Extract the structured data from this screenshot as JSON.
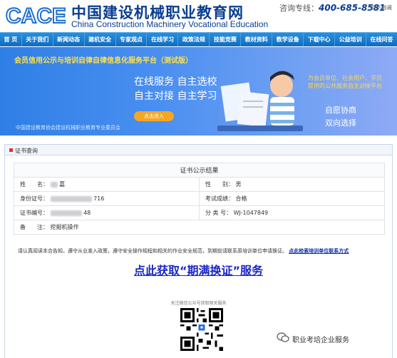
{
  "header": {
    "logo_letters": "CACE",
    "logo_cn": "中国建设机械职业教育网",
    "logo_en": "China Construction Machinery Vocational Education",
    "hotline_label": "咨询专线：",
    "hotline_number": "400-685-8581",
    "favorite": "加入收藏"
  },
  "nav": {
    "items": [
      "首 页",
      "关于我们",
      "新闻动态",
      "建机安全",
      "专家观点",
      "在线学习",
      "政策法规",
      "技能竞赛",
      "教材资料",
      "教学设备",
      "下载中心",
      "公益培训",
      "在线问答"
    ]
  },
  "banner": {
    "title": "会员信用公示与培训自律自律信息化服务平台（测试版）",
    "slogan1": "在线服务 自主选校",
    "slogan2": "自主对接 自主学习",
    "button": "点击进入",
    "org": "中国建设教育协会建设机械职业教育专业委员会",
    "right_text": "为会员单位、社会用户、学员提供的公共服务自主对接平台",
    "right2": "自愿协商",
    "right3": "双向选择"
  },
  "query": {
    "title": "证书查询"
  },
  "result": {
    "caption": "证书公示结果",
    "name_label": "姓　　名：",
    "name_value": "嘉",
    "gender_label": "性　　别：",
    "gender_value": "男",
    "id_label": "身份证号：",
    "id_value": "716",
    "exam_label": "考试成绩：",
    "exam_value": "合格",
    "cert_label": "证书编号：",
    "cert_value": "48",
    "class_label": "分 类 号：",
    "class_value": "WJ-1047849",
    "note_label": "备　　注：",
    "note_value": "挖掘机操作"
  },
  "notice": {
    "text": "请认真阅读本合告知，遵守从业准入政策，遵守安全操作规程和相关的作业安全规范，到期前请联系原培训单位申请换证。",
    "link": "点此检索培训单位联系方式"
  },
  "cta": {
    "text": "点此获取“期满换证”服务"
  },
  "follow": {
    "text": "关注微信公众号获取相关服务"
  },
  "watermark": {
    "text": "职业考培企业服务"
  },
  "colors": {
    "nav_blue": "#0f6cc0",
    "brand_navy": "#0a3d91",
    "banner_yellow": "#ffe04a",
    "cta_blue": "#1a27c8"
  }
}
